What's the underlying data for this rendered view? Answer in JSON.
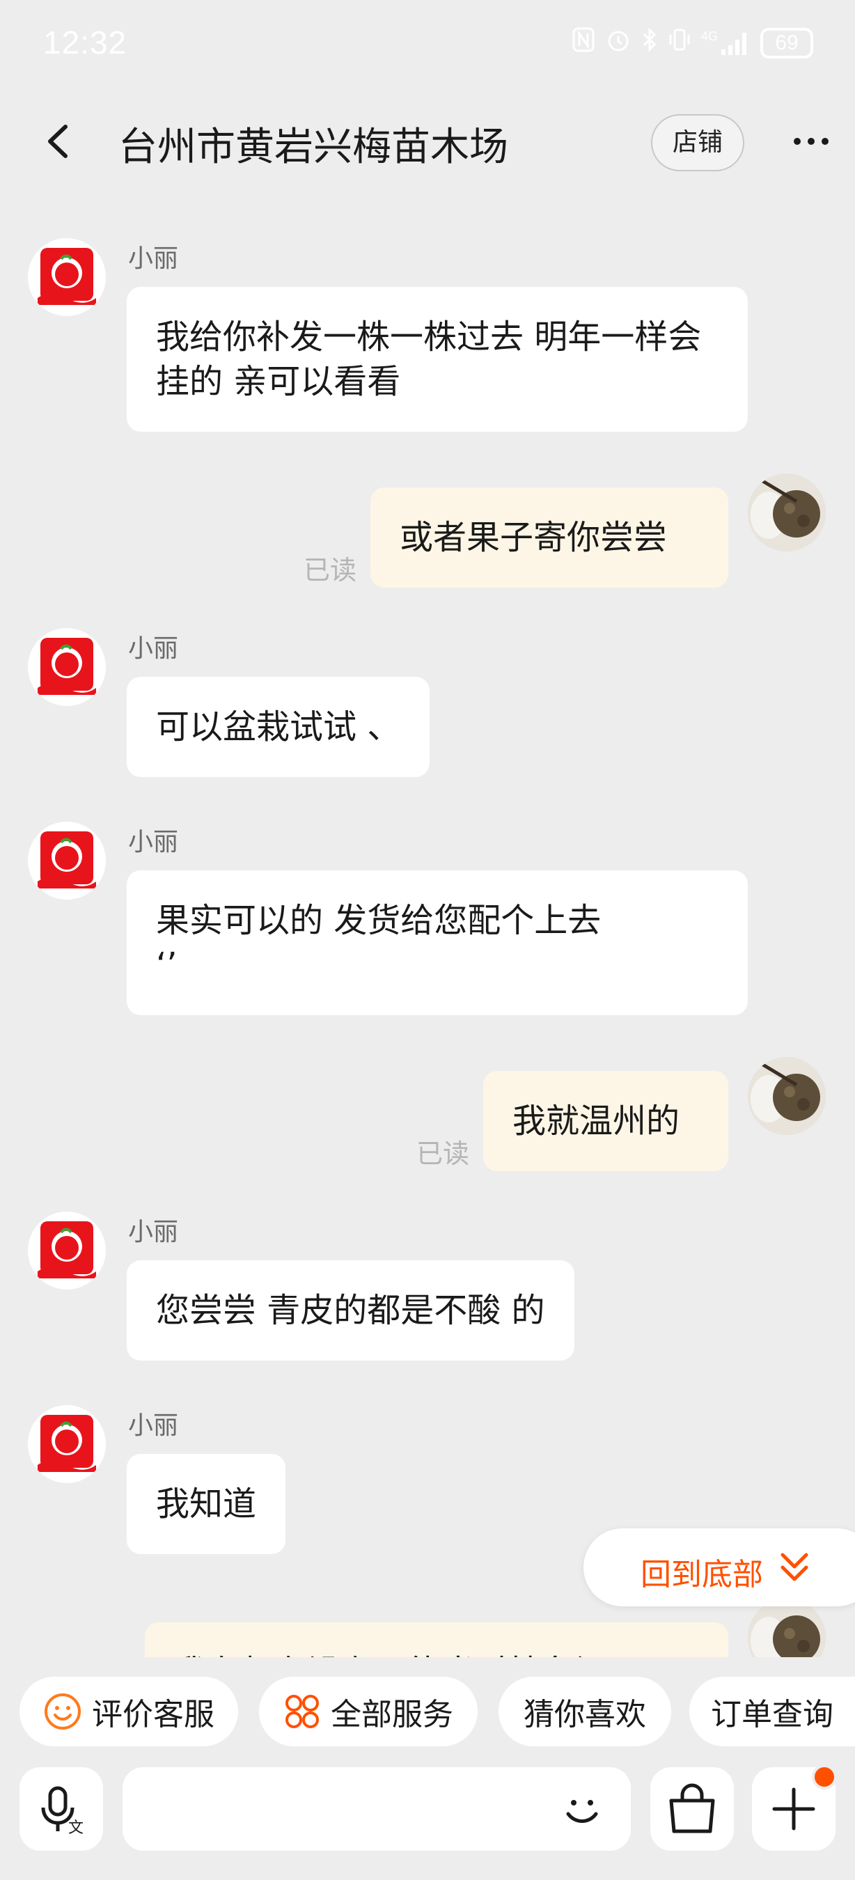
{
  "status_bar": {
    "time": "12:32",
    "network": "4G",
    "battery": "69"
  },
  "header": {
    "title": "台州市黄岩兴梅苗木场",
    "store_button": "店铺"
  },
  "messages": [
    {
      "sender": "小丽",
      "text": "我给你补发一株一株过去 明年一样会挂的 亲可以看看"
    },
    {
      "text": "或者果子寄你尝尝",
      "read": "已读"
    },
    {
      "sender": "小丽",
      "text": "可以盆栽试试 、"
    },
    {
      "sender": "小丽",
      "text": "果实可以的 发货给您配个上去 ‘’"
    },
    {
      "text": "我就温州的",
      "read": "已读"
    },
    {
      "sender": "小丽",
      "text": "您尝尝 青皮的都是不酸 的"
    },
    {
      "sender": "小丽",
      "text": "我知道"
    },
    {
      "text": "我在想有没有可能当时枝条湿了"
    }
  ],
  "scroll_to_bottom": {
    "label": "回到底部"
  },
  "quick_actions": [
    {
      "label": "评价客服",
      "icon": "smiley-icon"
    },
    {
      "label": "全部服务",
      "icon": "grid-icon"
    },
    {
      "label": "猜你喜欢"
    },
    {
      "label": "订单查询"
    }
  ],
  "input": {
    "placeholder": ""
  },
  "colors": {
    "accent": "#ff5000",
    "outgoing_bubble": "#fdf6e6",
    "incoming_bubble": "#ffffff",
    "background": "#ededed"
  }
}
